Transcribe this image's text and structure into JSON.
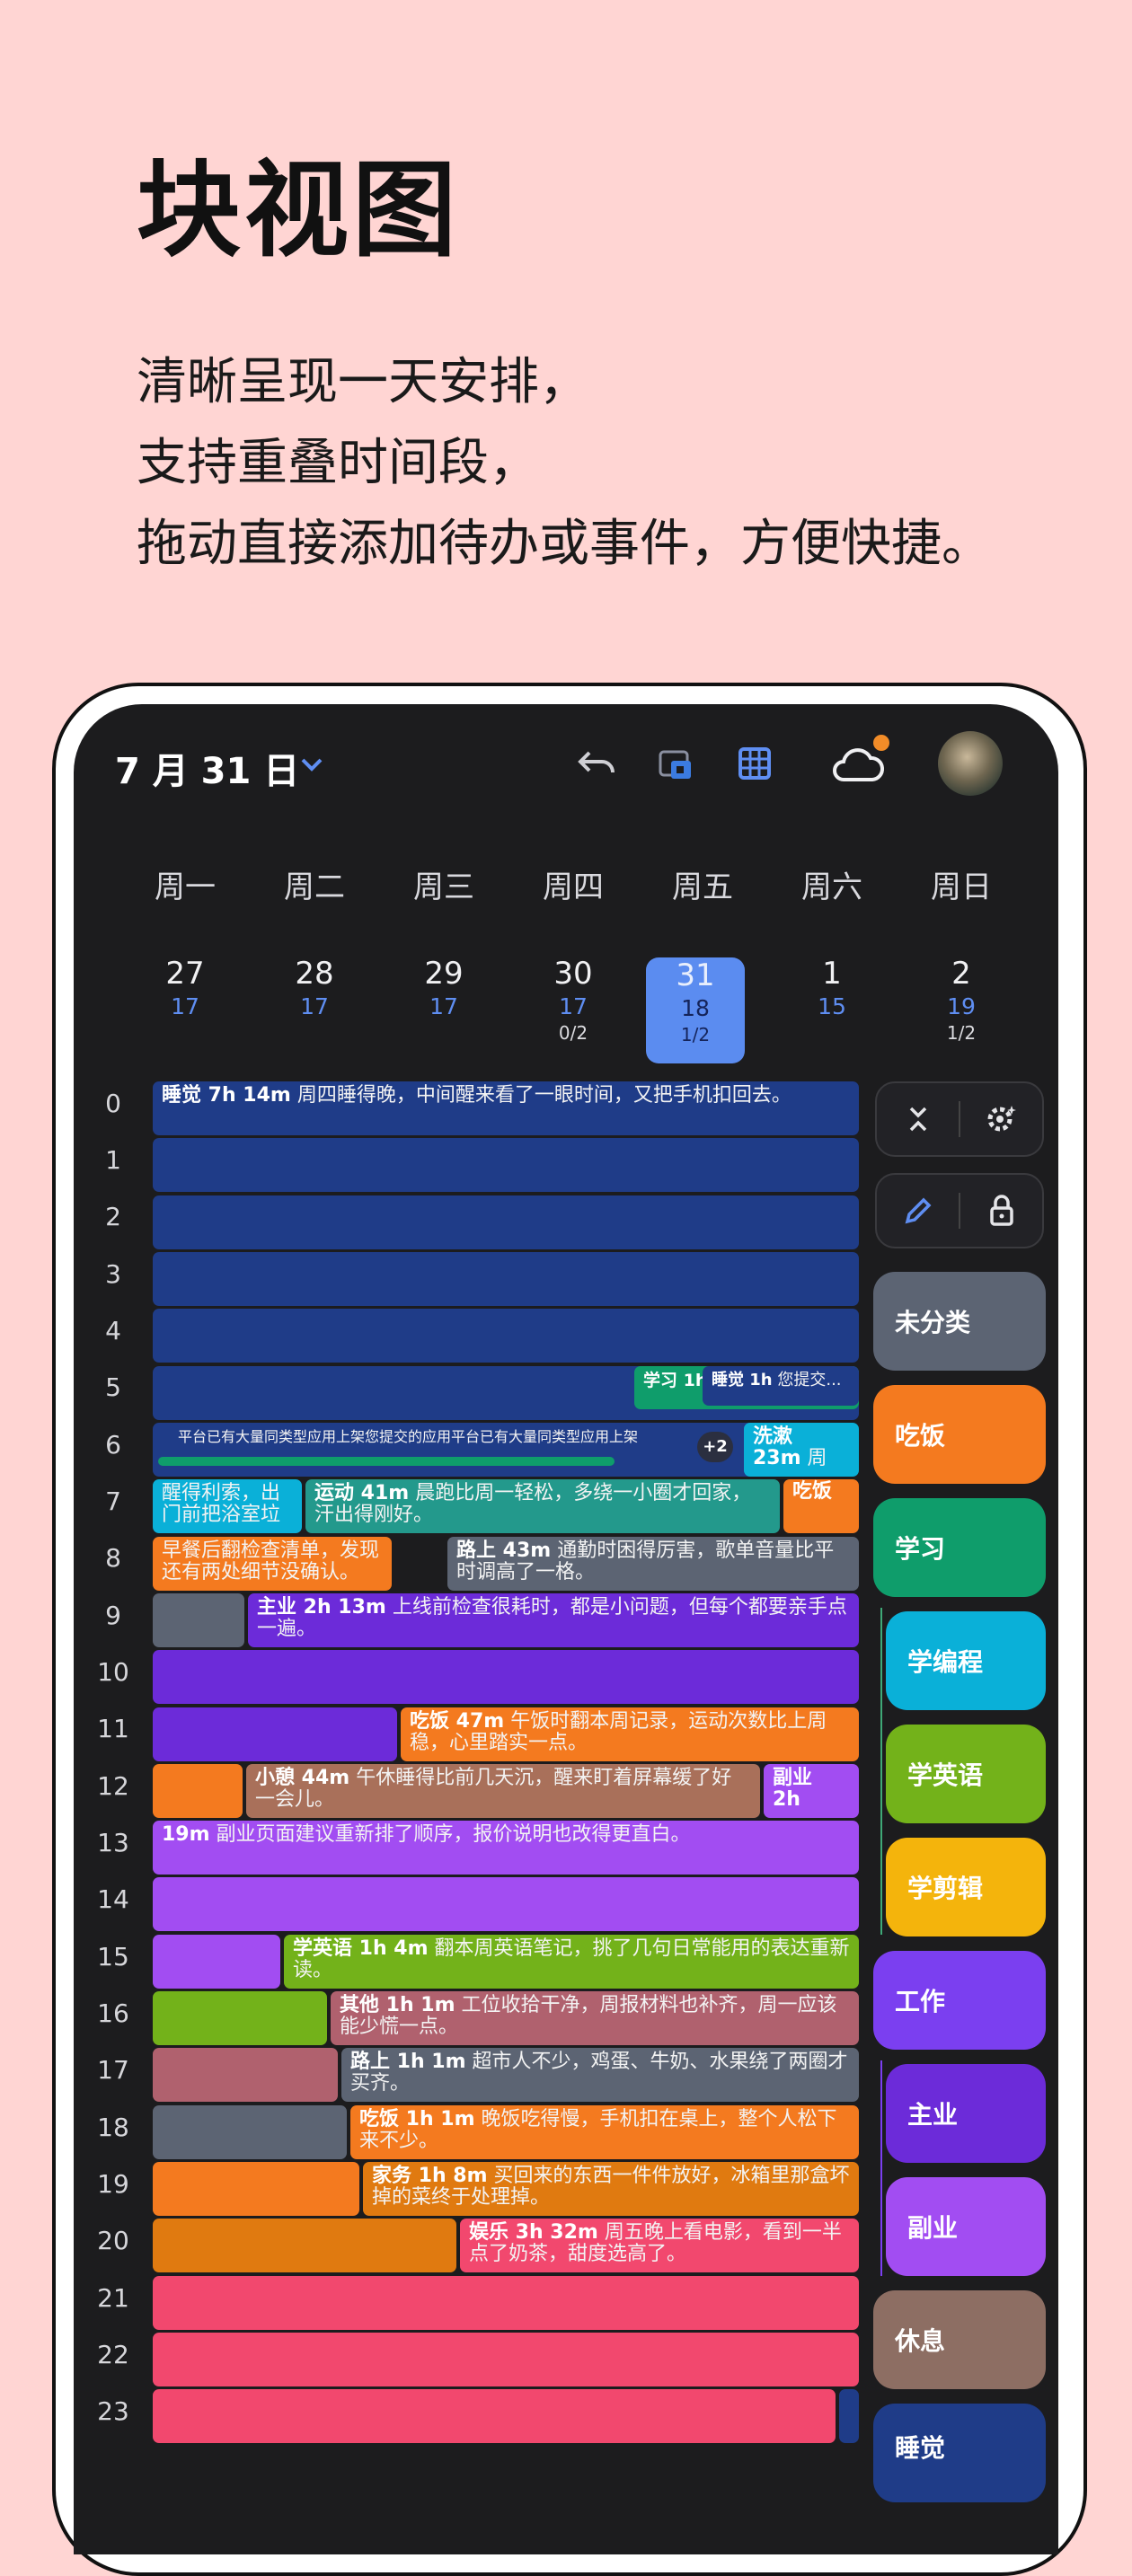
{
  "promo": {
    "headline": "块视图",
    "lines": [
      "清晰呈现一天安排，",
      "支持重叠时间段，",
      "拖动直接添加待办或事件，方便快捷。"
    ]
  },
  "header": {
    "date": "7 月 31 日",
    "icons": [
      "chevron-down-icon",
      "undo-icon",
      "calendar-swap-icon",
      "grid-view-icon",
      "cloud-sync-icon",
      "avatar"
    ]
  },
  "week": {
    "days": [
      "周一",
      "周二",
      "周三",
      "周四",
      "周五",
      "周六",
      "周日"
    ],
    "dates": [
      {
        "n": "27",
        "c": "17",
        "p": ""
      },
      {
        "n": "28",
        "c": "17",
        "p": ""
      },
      {
        "n": "29",
        "c": "17",
        "p": ""
      },
      {
        "n": "30",
        "c": "17",
        "p": "0/2"
      },
      {
        "n": "31",
        "c": "18",
        "p": "1/2"
      },
      {
        "n": "1",
        "c": "15",
        "p": ""
      },
      {
        "n": "2",
        "c": "19",
        "p": "1/2"
      }
    ]
  },
  "hours": [
    "0",
    "1",
    "2",
    "3",
    "4",
    "5",
    "6",
    "7",
    "8",
    "9",
    "10",
    "11",
    "12",
    "13",
    "14",
    "15",
    "16",
    "17",
    "18",
    "19",
    "20",
    "21",
    "22",
    "23"
  ],
  "blocks": {
    "sleep": {
      "t": "睡觉 7h 14m",
      "d": "周四睡得晚，中间醒来看了一眼时间，又把手机扣回去。"
    },
    "study5": {
      "t": "学习 1h"
    },
    "sleep5": {
      "t": "睡觉 1h",
      "d": "您提交..."
    },
    "notice": {
      "d": "平台已有大量同类型应用上架您提交的应用平台已有大量同类型应用上架"
    },
    "more": {
      "t": "+2"
    },
    "wash": {
      "t": "洗漱",
      "t2": "23m",
      "d": "周"
    },
    "wake": {
      "d": "醒得利索，出门前把浴室垃"
    },
    "sport": {
      "t": "运动 41m",
      "d": "晨跑比周一轻松，多绕一小圈才回家，汗出得刚好。"
    },
    "eat7": {
      "t": "吃饭"
    },
    "breakfast": {
      "d": "早餐后翻检查清单，发现还有两处细节没确认。"
    },
    "commute": {
      "t": "路上 43m",
      "d": "通勤时困得厉害，歌单音量比平时调高了一格。"
    },
    "main": {
      "t": "主业 2h 13m",
      "d": "上线前检查很耗时，都是小问题，但每个都要亲手点一遍。"
    },
    "lunch": {
      "t": "吃饭 47m",
      "d": "午饭时翻本周记录，运动次数比上周稳，心里踏实一点。"
    },
    "rest": {
      "t": "小憩 44m",
      "d": "午休睡得比前几天沉，醒来盯着屏幕缓了好一会儿。"
    },
    "side12": {
      "t": "副业",
      "t2": "2h"
    },
    "side13": {
      "t": "19m",
      "d": "副业页面建议重新排了顺序，报价说明也改得更直白。"
    },
    "english": {
      "t": "学英语 1h 4m",
      "d": "翻本周英语笔记，挑了几句日常能用的表达重新读。"
    },
    "other": {
      "t": "其他 1h 1m",
      "d": "工位收拾干净，周报材料也补齐，周一应该能少慌一点。"
    },
    "road17": {
      "t": "路上 1h 1m",
      "d": "超市人不少，鸡蛋、牛奶、水果绕了两圈才买齐。"
    },
    "dinner": {
      "t": "吃饭 1h 1m",
      "d": "晚饭吃得慢，手机扣在桌上，整个人松下来不少。"
    },
    "chores": {
      "t": "家务 1h 8m",
      "d": "买回来的东西一件件放好，冰箱里那盒坏掉的菜终于处理掉。"
    },
    "fun": {
      "t": "娱乐 3h 32m",
      "d": "周五晚上看电影，看到一半点了奶茶，甜度选高了。"
    }
  },
  "side_panel": {
    "categories": [
      "未分类",
      "吃饭",
      "学习",
      "学编程",
      "学英语",
      "学剪辑",
      "工作",
      "主业",
      "副业",
      "休息",
      "睡觉"
    ]
  },
  "colors": {
    "sleep": "#1f3c88",
    "study": "#0f9d6b",
    "cyan": "#0ab0d8",
    "orange": "#f47a1f",
    "teal": "#23998c",
    "gray": "#5c6473",
    "purple_dark": "#6c2bd9",
    "purple": "#a24df2",
    "brown": "#a9705a",
    "lime": "#73b21a",
    "rose": "#b0616e",
    "amber": "#e07a10",
    "pink": "#f2486e",
    "selected": "#5b8cf0"
  }
}
